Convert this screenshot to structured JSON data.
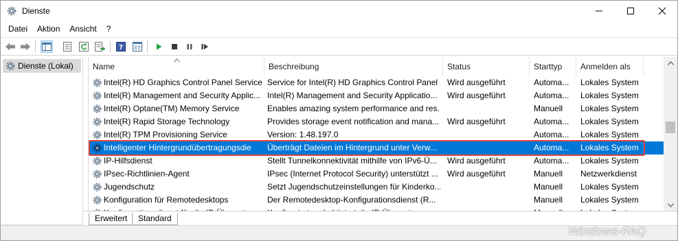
{
  "window": {
    "title": "Dienste"
  },
  "menu": [
    "Datei",
    "Aktion",
    "Ansicht",
    "?"
  ],
  "tree": {
    "item": "Dienste (Lokal)"
  },
  "columns": [
    "Name",
    "Beschreibung",
    "Status",
    "Starttyp",
    "Anmelden als"
  ],
  "rows": [
    {
      "name": "Intel(R) HD Graphics Control Panel Service",
      "desc": "Service for Intel(R) HD Graphics Control Panel",
      "status": "Wird ausgeführt",
      "start": "Automa...",
      "logon": "Lokales System",
      "selected": false
    },
    {
      "name": "Intel(R) Management and Security Applic...",
      "desc": "Intel(R) Management and Security Applicatio...",
      "status": "Wird ausgeführt",
      "start": "Automa...",
      "logon": "Lokales System",
      "selected": false
    },
    {
      "name": "Intel(R) Optane(TM) Memory Service",
      "desc": "Enables amazing system performance and res...",
      "status": "",
      "start": "Manuell",
      "logon": "Lokales System",
      "selected": false
    },
    {
      "name": "Intel(R) Rapid Storage Technology",
      "desc": "Provides storage event notification and mana...",
      "status": "Wird ausgeführt",
      "start": "Automa...",
      "logon": "Lokales System",
      "selected": false
    },
    {
      "name": "Intel(R) TPM Provisioning Service",
      "desc": "Version: 1.48.197.0",
      "status": "",
      "start": "Automa...",
      "logon": "Lokales System",
      "selected": false
    },
    {
      "name": "Intelligenter Hintergrundübertragungsdie",
      "desc": "Überträgt Dateien im Hintergrund unter Verw...",
      "status": "",
      "start": "Automa...",
      "logon": "Lokales System",
      "selected": true
    },
    {
      "name": "IP-Hilfsdienst",
      "desc": "Stellt Tunnelkonnektivität mithilfe von IPv6-Ü...",
      "status": "Wird ausgeführt",
      "start": "Automa...",
      "logon": "Lokales System",
      "selected": false
    },
    {
      "name": "IPsec-Richtlinien-Agent",
      "desc": "IPsec (Internet Protocol Security) unterstützt ...",
      "status": "Wird ausgeführt",
      "start": "Manuell",
      "logon": "Netzwerkdienst",
      "selected": false
    },
    {
      "name": "Jugendschutz",
      "desc": "Setzt Jugendschutzeinstellungen für Kinderko...",
      "status": "",
      "start": "Manuell",
      "logon": "Lokales System",
      "selected": false
    },
    {
      "name": "Konfiguration für Remotedesktops",
      "desc": "Der Remotedesktop-Konfigurationsdienst (R...",
      "status": "",
      "start": "Manuell",
      "logon": "Lokales System",
      "selected": false
    },
    {
      "name": "Konfigurationsdienst für die IP-Übersetzu...",
      "desc": "Konfiguriert und aktiviert die IP-Übersetzu...",
      "status": "",
      "start": "Manuell",
      "logon": "Lokales System",
      "selected": false
    }
  ],
  "tabs": [
    "Erweitert",
    "Standard"
  ],
  "watermark": "Windows-FAQ",
  "colors": {
    "selection": "#0078d7",
    "highlight_outline": "#e0443e"
  },
  "icons": [
    "services-gear-icon",
    "back-arrow-icon",
    "forward-arrow-icon",
    "console-tree-icon",
    "properties-icon",
    "refresh-icon",
    "export-list-icon",
    "help-icon",
    "show-hide-icon",
    "play-icon",
    "stop-icon",
    "pause-icon",
    "restart-icon"
  ]
}
